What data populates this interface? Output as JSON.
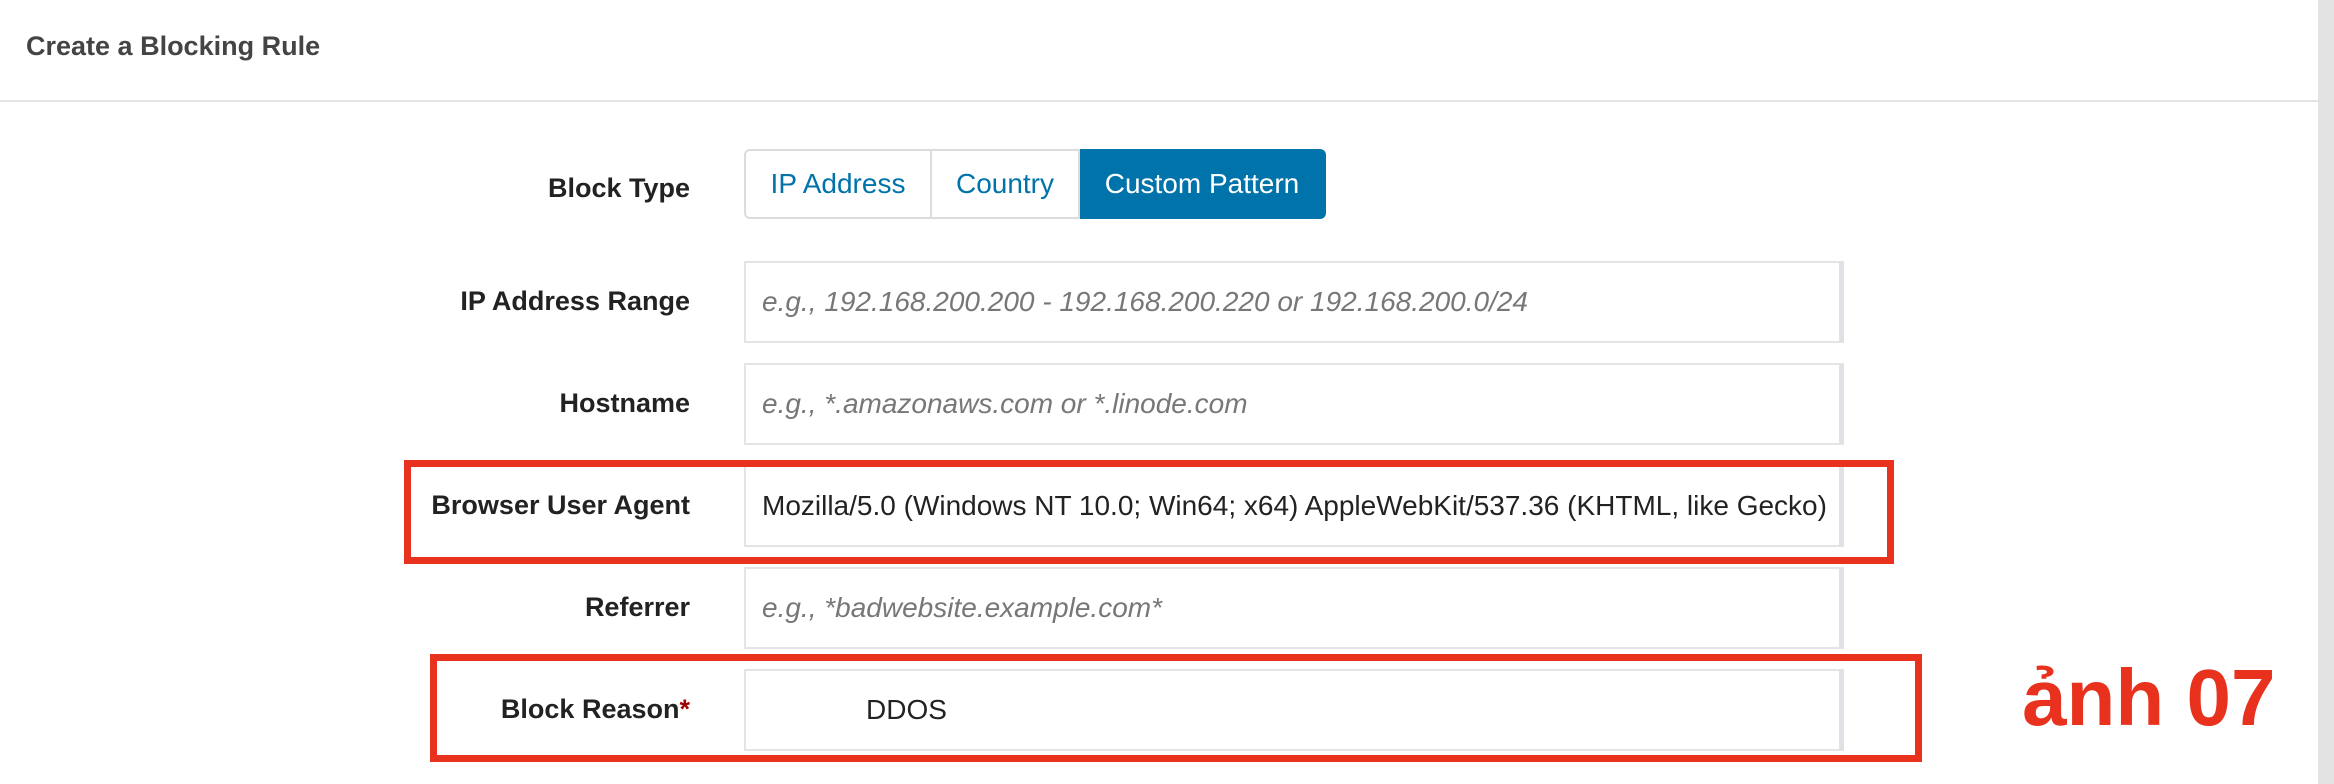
{
  "header": {
    "title": "Create a Blocking Rule"
  },
  "form": {
    "block_type": {
      "label": "Block Type",
      "options": [
        "IP Address",
        "Country",
        "Custom Pattern"
      ],
      "selected": "Custom Pattern"
    },
    "ip_range": {
      "label": "IP Address Range",
      "placeholder": "e.g., 192.168.200.200 - 192.168.200.220 or 192.168.200.0/24"
    },
    "hostname": {
      "label": "Hostname",
      "placeholder": "e.g., *.amazonaws.com or *.linode.com"
    },
    "user_agent": {
      "label": "Browser User Agent",
      "value": "Mozilla/5.0 (Windows NT 10.0; Win64; x64) AppleWebKit/537.36 (KHTML, like Gecko)"
    },
    "referrer": {
      "label": "Referrer",
      "placeholder": "e.g., *badwebsite.example.com*"
    },
    "block_reason": {
      "label": "Block Reason",
      "required_mark": "*",
      "value": "DDOS"
    }
  },
  "annotation": {
    "text": "ảnh 07",
    "color": "#e8321e"
  },
  "colors": {
    "accent": "#0073aa",
    "highlight": "#e8321e"
  }
}
